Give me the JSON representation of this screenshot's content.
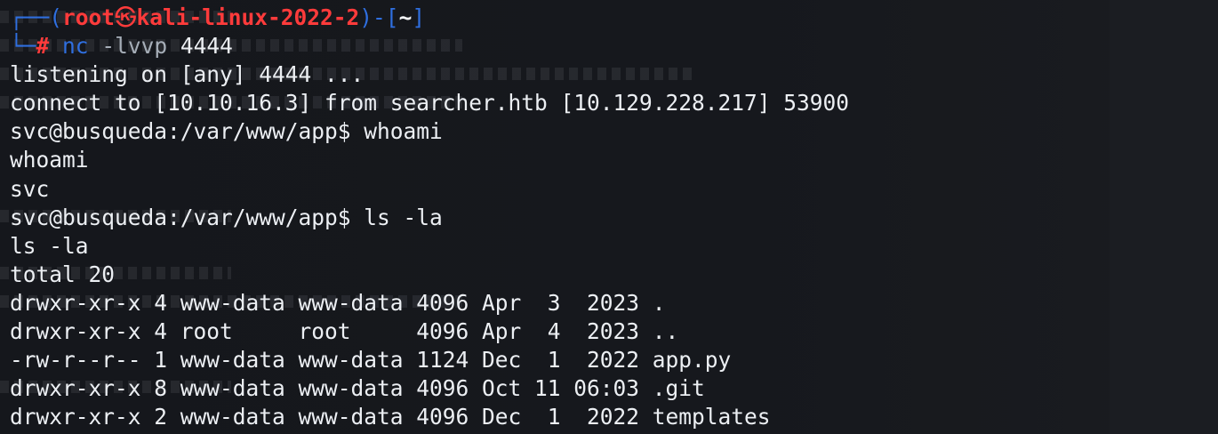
{
  "terminal": {
    "prompt": {
      "frame_top_left": "┌──(",
      "user": "root",
      "separator_icon": "㉿",
      "host": "kali-linux-2022-2",
      "frame_mid": ")-[",
      "cwd": "~",
      "frame_top_right": "]",
      "frame_bottom": "└─",
      "symbol": "#",
      "command": "nc",
      "flags": "-lvvp",
      "port": "4444"
    },
    "output": [
      "listening on [any] 4444 ...",
      "connect to [10.10.16.3] from searcher.htb [10.129.228.217] 53900",
      "svc@busqueda:/var/www/app$ whoami",
      "whoami",
      "svc",
      "svc@busqueda:/var/www/app$ ls -la",
      "ls -la",
      "total 20",
      "drwxr-xr-x 4 www-data www-data 4096 Apr  3  2023 .",
      "drwxr-xr-x 4 root     root     4096 Apr  4  2023 ..",
      "-rw-r--r-- 1 www-data www-data 1124 Dec  1  2022 app.py",
      "drwxr-xr-x 8 www-data www-data 4096 Oct 11 06:03 .git",
      "drwxr-xr-x 2 www-data www-data 4096 Dec  1  2022 templates"
    ]
  },
  "colors": {
    "background": "#16181d",
    "prompt_frame": "#2f6fe0",
    "prompt_user": "#ff3b3b",
    "text": "#eceff3"
  }
}
